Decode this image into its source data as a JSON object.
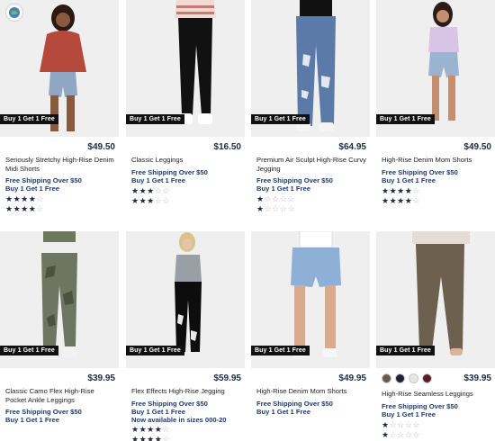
{
  "products": [
    {
      "badge": "Buy 1 Get 1 Free",
      "price": "$49.50",
      "name": "Seriously Stretchy High-Rise Denim Midi Shorts",
      "promo1": "Free Shipping Over $50",
      "promo2": "Buy 1 Get 1 Free",
      "promo3": "",
      "rating1": 4,
      "rating2": 4
    },
    {
      "badge": "Buy 1 Get 1 Free",
      "price": "$16.50",
      "name": "Classic Leggings",
      "promo1": "Free Shipping Over $50",
      "promo2": "Buy 1 Get 1 Free",
      "promo3": "",
      "rating1": 3,
      "rating2": 3
    },
    {
      "badge": "Buy 1 Get 1 Free",
      "price": "$64.95",
      "name": "Premium Air Sculpt High-Rise Curvy Jegging",
      "promo1": "Free Shipping Over $50",
      "promo2": "Buy 1 Get 1 Free",
      "promo3": "",
      "rating1": 1,
      "rating2": 1
    },
    {
      "badge": "Buy 1 Get 1 Free",
      "price": "$49.50",
      "name": "High-Rise Denim Mom Shorts",
      "promo1": "Free Shipping Over $50",
      "promo2": "Buy 1 Get 1 Free",
      "promo3": "",
      "rating1": 4,
      "rating2": 4
    },
    {
      "badge": "Buy 1 Get 1 Free",
      "price": "$39.95",
      "name": "Classic Camo Flex High-Rise Pocket Ankle Leggings",
      "promo1": "Free Shipping Over $50",
      "promo2": "Buy 1 Get 1 Free",
      "promo3": "",
      "rating1": 0,
      "rating2": 0
    },
    {
      "badge": "Buy 1 Get 1 Free",
      "price": "$59.95",
      "name": "Flex Effects High-Rise Jegging",
      "promo1": "Free Shipping Over $50",
      "promo2": "Buy 1 Get 1 Free",
      "promo3": "Now available in sizes 000-20",
      "rating1": 4,
      "rating2": 4
    },
    {
      "badge": "Buy 1 Get 1 Free",
      "price": "$49.95",
      "name": "High-Rise Denim Mom Shorts",
      "promo1": "Free Shipping Over $50",
      "promo2": "Buy 1 Get 1 Free",
      "promo3": "",
      "rating1": 0,
      "rating2": 0
    },
    {
      "badge": "Buy 1 Get 1 Free",
      "price": "$39.95",
      "name": "High-Rise Seamless Leggings",
      "promo1": "Free Shipping Over $50",
      "promo2": "Buy 1 Get 1 Free",
      "promo3": "",
      "rating1": 1,
      "rating2": 1,
      "swatches": [
        "#6b5a4a",
        "#1c2233",
        "#e8e6e2",
        "#5a1e2a"
      ]
    }
  ],
  "colors": {
    "accent": "#1e3a6e",
    "badge_bg": "#111111",
    "star_on": "#1f2a44",
    "star_off": "#b8bcc6"
  },
  "icons": {
    "logo": "globe-logo-icon",
    "star": "star-icon"
  }
}
